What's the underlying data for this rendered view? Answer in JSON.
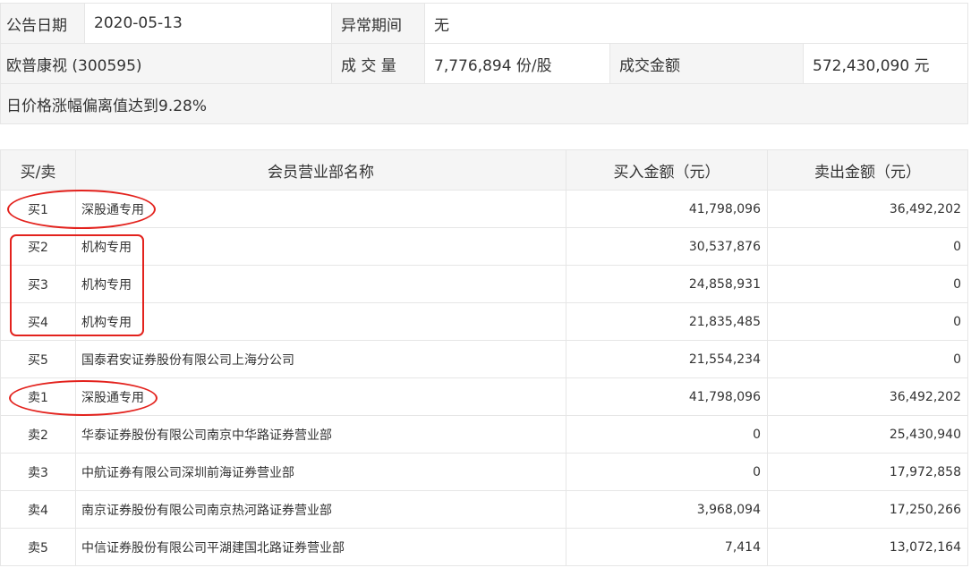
{
  "info": {
    "date_label": "公告日期",
    "date_value": "2020-05-13",
    "period_label": "异常期间",
    "period_value": "无",
    "stock": "欧普康视 (300595)",
    "volume_label": "成 交 量",
    "volume_value": "7,776,894 份/股",
    "amount_label": "成交金额",
    "amount_value": "572,430,090 元",
    "reason": "日价格涨幅偏离值达到9.28%"
  },
  "table": {
    "headers": [
      "买/卖",
      "会员营业部名称",
      "买入金额（元）",
      "卖出金额（元）"
    ],
    "rows": [
      {
        "side": "买1",
        "name": "深股通专用",
        "buy": "41,798,096",
        "sell": "36,492,202"
      },
      {
        "side": "买2",
        "name": "机构专用",
        "buy": "30,537,876",
        "sell": "0"
      },
      {
        "side": "买3",
        "name": "机构专用",
        "buy": "24,858,931",
        "sell": "0"
      },
      {
        "side": "买4",
        "name": "机构专用",
        "buy": "21,835,485",
        "sell": "0"
      },
      {
        "side": "买5",
        "name": "国泰君安证券股份有限公司上海分公司",
        "buy": "21,554,234",
        "sell": "0"
      },
      {
        "side": "卖1",
        "name": "深股通专用",
        "buy": "41,798,096",
        "sell": "36,492,202"
      },
      {
        "side": "卖2",
        "name": "华泰证券股份有限公司南京中华路证券营业部",
        "buy": "0",
        "sell": "25,430,940"
      },
      {
        "side": "卖3",
        "name": "中航证券有限公司深圳前海证券营业部",
        "buy": "0",
        "sell": "17,972,858"
      },
      {
        "side": "卖4",
        "name": "南京证券股份有限公司南京热河路证券营业部",
        "buy": "3,968,094",
        "sell": "17,250,266"
      },
      {
        "side": "卖5",
        "name": "中信证券股份有限公司平湖建国北路证券营业部",
        "buy": "7,414",
        "sell": "13,072,164"
      }
    ]
  },
  "annotation_color": "#e3221d"
}
